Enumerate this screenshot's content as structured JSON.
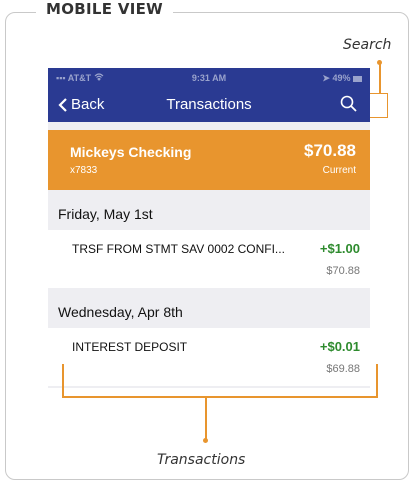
{
  "frame": {
    "title": "MOBILE VIEW"
  },
  "callouts": {
    "search": "Search",
    "transactions": "Transactions"
  },
  "statusbar": {
    "carrier": "AT&T",
    "time": "9:31 AM",
    "battery": "49%"
  },
  "navbar": {
    "back_label": "Back",
    "title": "Transactions"
  },
  "account": {
    "name": "Mickeys Checking",
    "number": "x7833",
    "balance": "$70.88",
    "status": "Current"
  },
  "groups": [
    {
      "date": "Friday, May 1st",
      "transactions": [
        {
          "description": "TRSF FROM STMT SAV 0002 CONFI...",
          "amount": "+$1.00",
          "balance": "$70.88"
        }
      ]
    },
    {
      "date": "Wednesday, Apr 8th",
      "transactions": [
        {
          "description": "INTEREST DEPOSIT",
          "amount": "+$0.01",
          "balance": "$69.88"
        }
      ]
    }
  ],
  "colors": {
    "nav": "#2a3a92",
    "account": "#e8952e",
    "credit": "#2e8b2e",
    "callout": "#e8952e"
  },
  "icons": {
    "back": "chevron-left-icon",
    "search": "search-icon",
    "wifi": "wifi-icon",
    "location": "location-arrow-icon",
    "battery": "battery-icon"
  }
}
